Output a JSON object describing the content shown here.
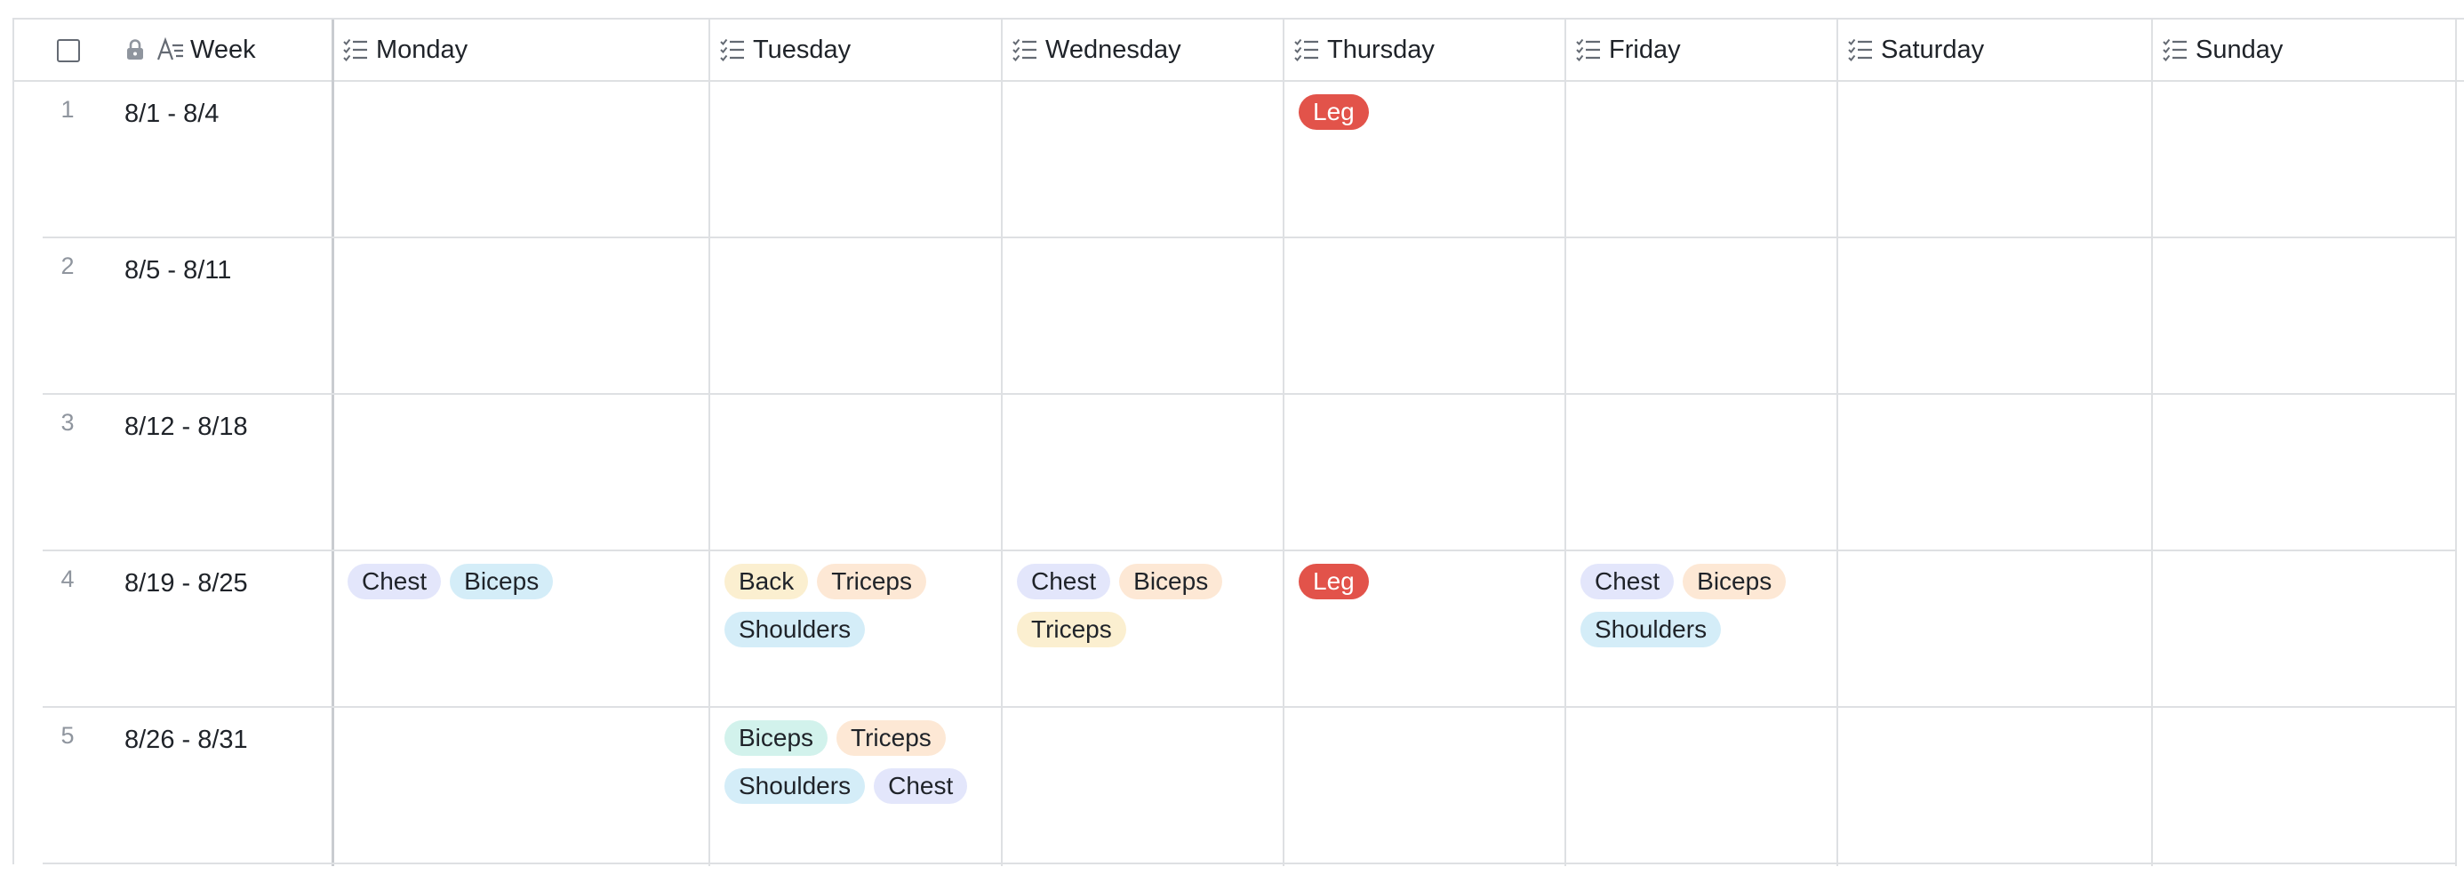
{
  "header": {
    "week_label": "Week",
    "days": [
      "Monday",
      "Tuesday",
      "Wednesday",
      "Thursday",
      "Friday",
      "Saturday",
      "Sunday"
    ],
    "field_icon": "checklist-icon",
    "lock_icon": "lock-icon",
    "text_field_icon": "text-field-icon"
  },
  "rows": [
    {
      "num": "1",
      "week": "8/1 - 8/4",
      "cells": [
        [],
        [],
        [],
        [
          {
            "label": "Leg",
            "style": "Leg"
          }
        ],
        [],
        [],
        []
      ]
    },
    {
      "num": "2",
      "week": "8/5 - 8/11",
      "cells": [
        [],
        [],
        [],
        [],
        [],
        [],
        []
      ]
    },
    {
      "num": "3",
      "week": "8/12 - 8/18",
      "cells": [
        [],
        [],
        [],
        [],
        [],
        [],
        []
      ]
    },
    {
      "num": "4",
      "week": "8/19 - 8/25",
      "cells": [
        [
          {
            "label": "Chest",
            "style": "Chest"
          },
          {
            "label": "Biceps",
            "style": "Biceps-a"
          }
        ],
        [
          {
            "label": "Back",
            "style": "Back"
          },
          {
            "label": "Triceps",
            "style": "Triceps-a"
          },
          {
            "label": "Shoulders",
            "style": "Shoulders"
          }
        ],
        [
          {
            "label": "Chest",
            "style": "Chest"
          },
          {
            "label": "Biceps",
            "style": "Biceps-b"
          },
          {
            "label": "Triceps",
            "style": "Triceps-b"
          }
        ],
        [
          {
            "label": "Leg",
            "style": "Leg"
          }
        ],
        [
          {
            "label": "Chest",
            "style": "Chest"
          },
          {
            "label": "Biceps",
            "style": "Biceps-b"
          },
          {
            "label": "Shoulders",
            "style": "Shoulders"
          }
        ],
        [],
        []
      ]
    },
    {
      "num": "5",
      "week": "8/26 - 8/31",
      "cells": [
        [],
        [
          {
            "label": "Biceps",
            "style": "Biceps-c"
          },
          {
            "label": "Triceps",
            "style": "Triceps-a"
          },
          {
            "label": "Shoulders",
            "style": "Shoulders"
          },
          {
            "label": "Chest",
            "style": "Chest"
          }
        ],
        [],
        [],
        [],
        [],
        []
      ]
    }
  ],
  "colors": {
    "leg": "#e2534a",
    "chest": "#e3e6fb",
    "blue": "#d4edf8",
    "peach": "#fde8d5",
    "yellow": "#fbefd0",
    "mint": "#d2f2ec",
    "grid": "#dee0e3"
  }
}
